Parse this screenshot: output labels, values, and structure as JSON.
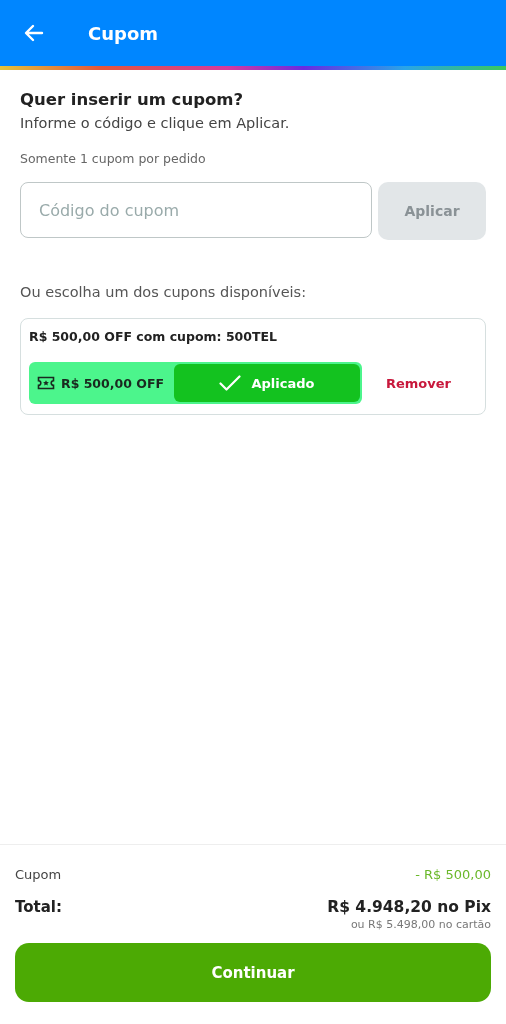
{
  "header": {
    "title": "Cupom"
  },
  "intro": {
    "heading": "Quer inserir um cupom?",
    "subtitle": "Informe o código e clique em Aplicar.",
    "note": "Somente 1 cupom por pedido"
  },
  "code_field": {
    "placeholder": "Código do cupom"
  },
  "apply_button": {
    "label": "Aplicar",
    "disabled": true
  },
  "available_label": "Ou escolha um dos cupons disponíveis:",
  "coupons": [
    {
      "title": "R$ 500,00 OFF com cupom: 500TEL",
      "value": "R$ 500,00 OFF",
      "status": "Aplicado",
      "applied": true,
      "remove_label": "Remover"
    }
  ],
  "summary": {
    "coupon_label": "Cupom",
    "coupon_value": "- R$ 500,00",
    "total_label": "Total:",
    "total_value": "R$ 4.948,20 no Pix",
    "card_value": "ou R$ 5.498,00 no cartão"
  },
  "continue_button": {
    "label": "Continuar"
  }
}
